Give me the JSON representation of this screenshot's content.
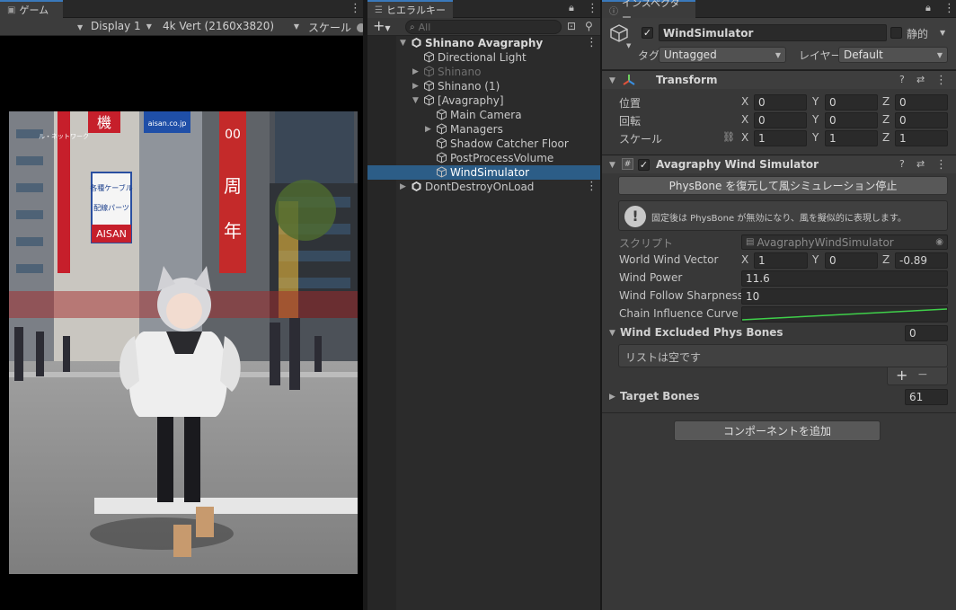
{
  "game": {
    "tab_label": "ゲーム",
    "display": "Display 1",
    "resolution": "4k Vert (2160x3820)",
    "scale_label": "スケール",
    "scene_colors": {
      "sky": "#dfe6ee",
      "road": "#8e8e8e",
      "buildings": "#6b7075"
    },
    "sign_texts": [
      "機",
      "aisan.co.jp",
      "各種ケーブル",
      "配線パーツ",
      "AISAN",
      "ル・ネットワーク",
      "00",
      "周",
      "年"
    ]
  },
  "hierarchy": {
    "tab_label": "ヒエラルキー",
    "search_placeholder": "All",
    "add_label": "+",
    "items": [
      {
        "label": "Shinano Avagraphy",
        "indent": 0,
        "arrow": "▼",
        "icon": "unity-scene-icon",
        "bold": true,
        "dim": false,
        "selected": false,
        "kebab": true
      },
      {
        "label": "Directional Light",
        "indent": 1,
        "arrow": "",
        "icon": "gameobject-cube-icon",
        "bold": false,
        "dim": false,
        "selected": false,
        "kebab": false
      },
      {
        "label": "Shinano",
        "indent": 1,
        "arrow": "▶",
        "icon": "gameobject-cube-icon",
        "bold": false,
        "dim": true,
        "selected": false,
        "kebab": false
      },
      {
        "label": "Shinano (1)",
        "indent": 1,
        "arrow": "▶",
        "icon": "gameobject-cube-icon",
        "bold": false,
        "dim": false,
        "selected": false,
        "kebab": false
      },
      {
        "label": "[Avagraphy]",
        "indent": 1,
        "arrow": "▼",
        "icon": "gameobject-cube-icon",
        "bold": false,
        "dim": false,
        "selected": false,
        "kebab": false
      },
      {
        "label": "Main Camera",
        "indent": 2,
        "arrow": "",
        "icon": "gameobject-cube-icon",
        "bold": false,
        "dim": false,
        "selected": false,
        "kebab": false
      },
      {
        "label": "Managers",
        "indent": 2,
        "arrow": "▶",
        "icon": "gameobject-cube-icon",
        "bold": false,
        "dim": false,
        "selected": false,
        "kebab": false
      },
      {
        "label": "Shadow Catcher Floor",
        "indent": 2,
        "arrow": "",
        "icon": "gameobject-cube-icon",
        "bold": false,
        "dim": false,
        "selected": false,
        "kebab": false
      },
      {
        "label": "PostProcessVolume",
        "indent": 2,
        "arrow": "",
        "icon": "gameobject-cube-icon",
        "bold": false,
        "dim": false,
        "selected": false,
        "kebab": false
      },
      {
        "label": "WindSimulator",
        "indent": 2,
        "arrow": "",
        "icon": "gameobject-cube-icon",
        "bold": false,
        "dim": false,
        "selected": true,
        "kebab": false
      },
      {
        "label": "DontDestroyOnLoad",
        "indent": 0,
        "arrow": "▶",
        "icon": "unity-scene-icon",
        "bold": false,
        "dim": false,
        "selected": false,
        "kebab": true
      }
    ]
  },
  "inspector": {
    "tab_label": "インスペクター",
    "object_name": "WindSimulator",
    "static_label": "静的",
    "tag_label": "タグ",
    "tag_value": "Untagged",
    "layer_label": "レイヤー",
    "layer_value": "Default",
    "transform": {
      "title": "Transform",
      "position_label": "位置",
      "rotation_label": "回転",
      "scale_label": "スケール",
      "position": {
        "x": "0",
        "y": "0",
        "z": "0"
      },
      "rotation": {
        "x": "0",
        "y": "0",
        "z": "0"
      },
      "scale": {
        "x": "1",
        "y": "1",
        "z": "1"
      }
    },
    "wind": {
      "title": "Avagraphy Wind Simulator",
      "stop_button": "PhysBone を復元して風シミュレーション停止",
      "help_text": "固定後は PhysBone が無効になり、風を擬似的に表現します。",
      "script_label": "スクリプト",
      "script_value": "AvagraphyWindSimulator",
      "vector_label": "World Wind Vector",
      "vector": {
        "x": "1",
        "y": "0",
        "z": "-0.89"
      },
      "power_label": "Wind Power",
      "power": "11.6",
      "sharpness_label": "Wind Follow Sharpness",
      "sharpness": "10",
      "curve_label": "Chain Influence Curve",
      "excluded_label": "Wind Excluded Phys Bones",
      "excluded_count": "0",
      "empty_list": "リストは空です",
      "add": "+",
      "remove": "−",
      "target_label": "Target Bones",
      "target_count": "61"
    },
    "add_component": "コンポーネントを追加"
  }
}
